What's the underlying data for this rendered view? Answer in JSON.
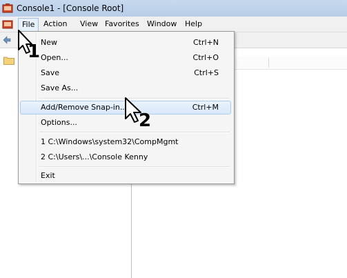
{
  "window": {
    "title": "Console1 - [Console Root]",
    "app_icon": "mmc-console-icon"
  },
  "menubar": {
    "items": [
      {
        "label": "File"
      },
      {
        "label": "Action"
      },
      {
        "label": "View"
      },
      {
        "label": "Favorites"
      },
      {
        "label": "Window"
      },
      {
        "label": "Help"
      }
    ]
  },
  "toolbar": {
    "back_icon": "back-arrow-icon"
  },
  "tree": {
    "root_icon": "folder-icon"
  },
  "file_menu": {
    "items": [
      {
        "label": "New",
        "shortcut": "Ctrl+N"
      },
      {
        "label": "Open...",
        "shortcut": "Ctrl+O"
      },
      {
        "label": "Save",
        "shortcut": "Ctrl+S"
      },
      {
        "label": "Save As...",
        "shortcut": ""
      },
      {
        "label": "Add/Remove Snap-in...",
        "shortcut": "Ctrl+M",
        "highlighted": true
      },
      {
        "label": "Options...",
        "shortcut": ""
      },
      {
        "label": "1 C:\\Windows\\system32\\CompMgmt",
        "shortcut": ""
      },
      {
        "label": "2 C:\\Users\\...\\Console Kenny",
        "shortcut": ""
      },
      {
        "label": "Exit",
        "shortcut": ""
      }
    ]
  },
  "annotations": {
    "step1": "1",
    "step2": "2"
  },
  "colors": {
    "titlebar": "#c6d9ee",
    "highlight": "#d9e8f9",
    "menu_bg": "#f5f5f5"
  }
}
